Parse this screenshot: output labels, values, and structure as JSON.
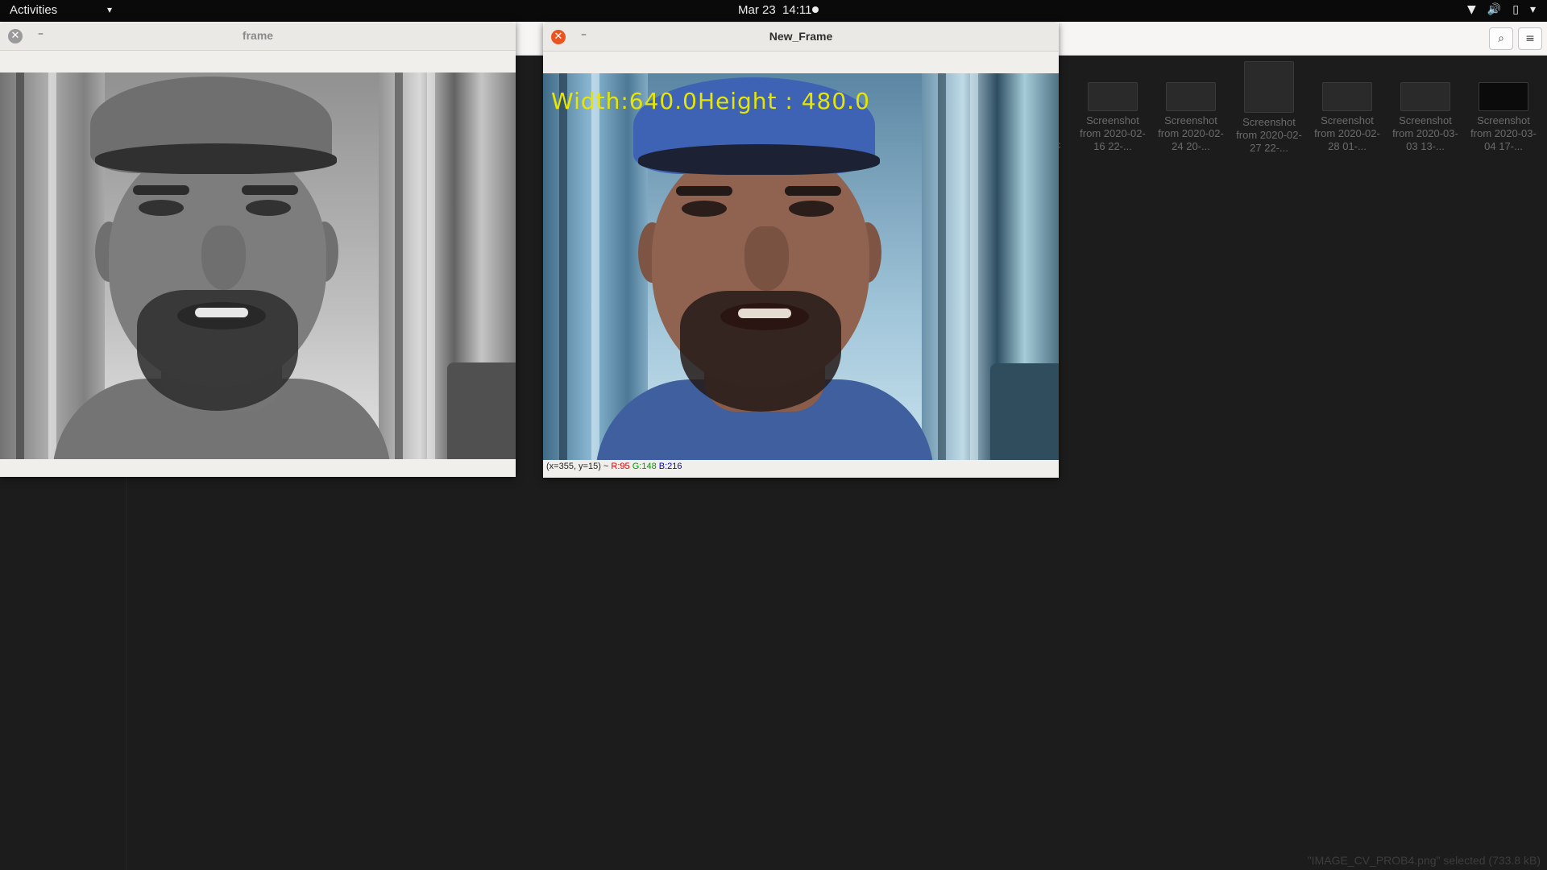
{
  "topbar": {
    "activities": "Activities",
    "date": "Mar 23",
    "time": "14:11",
    "tray_icons": [
      "wifi-icon",
      "volume-icon",
      "battery-icon",
      "system-menu-arrow-icon"
    ]
  },
  "file_manager": {
    "partial_label": "c",
    "items": [
      {
        "label": "Screenshot from 2020-02-16 22-...",
        "thumb": "screenshot-thumbnail"
      },
      {
        "label": "Screenshot from 2020-02-24 20-...",
        "thumb": "screenshot-thumbnail"
      },
      {
        "label": "Screenshot from 2020-02-27 22-...",
        "thumb": "screenshot-thumbnail"
      },
      {
        "label": "Screenshot from 2020-02-28 01-...",
        "thumb": "screenshot-thumbnail"
      },
      {
        "label": "Screenshot from 2020-03-03 13-...",
        "thumb": "screenshot-thumbnail"
      },
      {
        "label": "Screenshot from 2020-03-04 17-...",
        "thumb": "screenshot-thumbnail"
      }
    ],
    "status": "\"IMAGE_CV_PROB4.png\" selected (733.8 kB)"
  },
  "window_frame": {
    "title": "frame",
    "close_symbol": "✕",
    "minimize_symbol": "–",
    "colors": {
      "close_bg": "#9a9a9a"
    }
  },
  "window_new_frame": {
    "title": "New_Frame",
    "close_symbol": "✕",
    "minimize_symbol": "–",
    "overlay_text": "Width:640.0Height : 480.0",
    "status": {
      "coords": "(x=355, y=15) ~ ",
      "r": "R:95",
      "g": "G:148",
      "b": "B:216"
    },
    "colors": {
      "close_bg": "#e95420",
      "overlay": "#e6e600"
    }
  }
}
